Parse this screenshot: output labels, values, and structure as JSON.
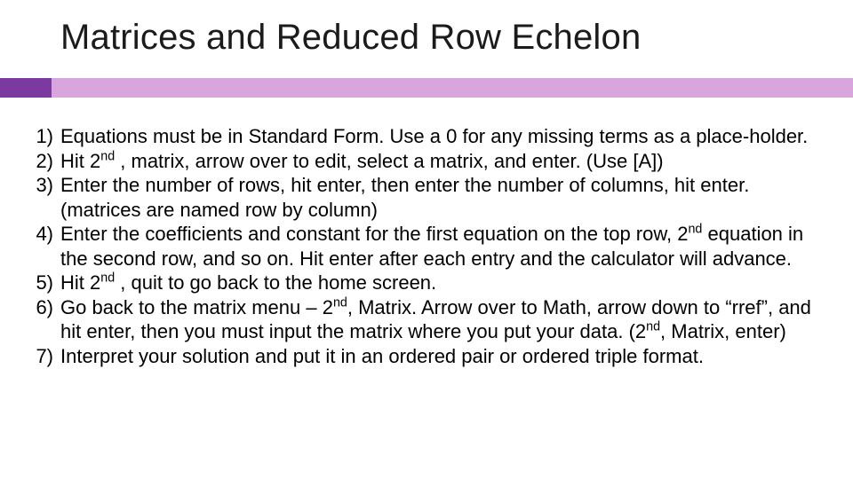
{
  "title": "Matrices and Reduced Row Echelon",
  "items": [
    {
      "num": "1)",
      "html": "Equations must be in Standard Form. Use a 0 for any missing terms as a place-holder."
    },
    {
      "num": "2)",
      "html": "Hit 2<sup>nd</sup> , matrix, arrow over to edit, select a matrix, and enter. (Use [A])"
    },
    {
      "num": "3)",
      "html": "Enter the number of rows, hit enter, then enter the number of columns, hit enter. (matrices are named row by column)"
    },
    {
      "num": "4)",
      "html": "Enter the coefficients and constant for the first equation on the top row, 2<sup>nd</sup> equation in the second row, and so on. Hit enter after each entry and the calculator will advance."
    },
    {
      "num": "5)",
      "html": "Hit 2<sup>nd</sup> , quit to go back to the home screen."
    },
    {
      "num": "6)",
      "html": "Go back to the matrix menu – 2<sup>nd</sup>, Matrix. Arrow over to Math, arrow down to “rref”, and hit enter, then you must input the matrix where you put your data. (2<sup>nd</sup>, Matrix, enter)"
    },
    {
      "num": "7)",
      "html": "Interpret your solution and put it in an ordered pair or ordered triple format."
    }
  ],
  "colors": {
    "accent_dark": "#7c3aa0",
    "accent_light": "#d8a6dc"
  }
}
